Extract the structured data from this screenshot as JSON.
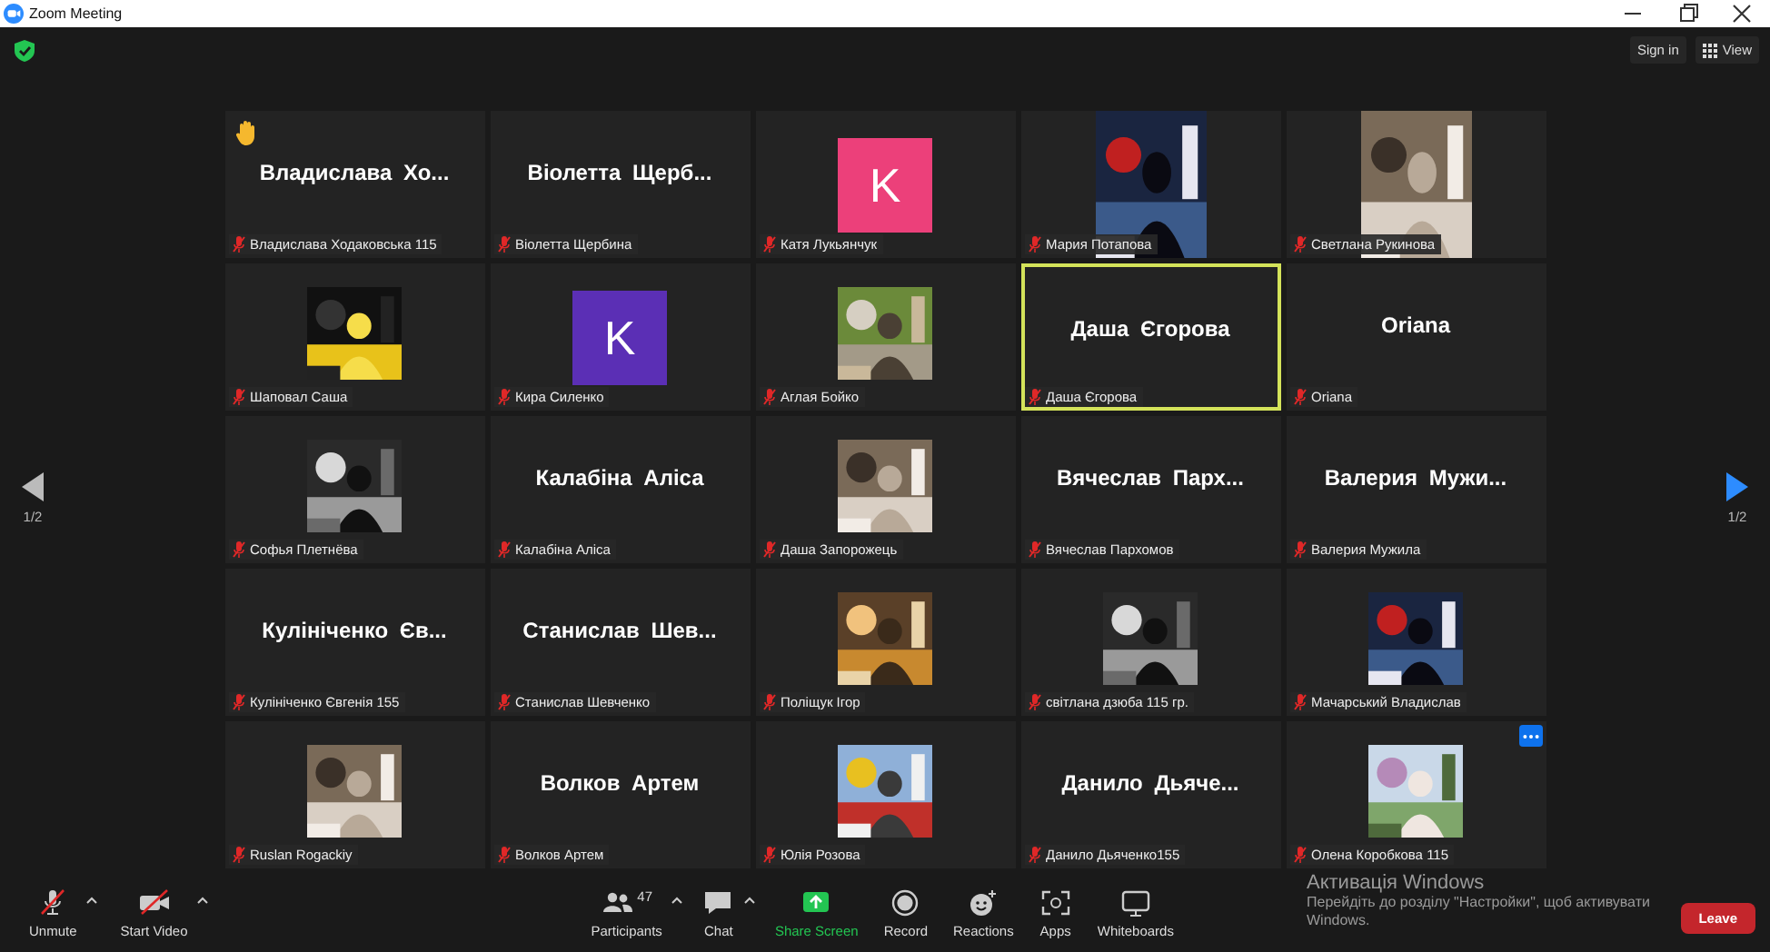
{
  "window": {
    "title": "Zoom Meeting"
  },
  "top_bar": {
    "sign_in": "Sign in",
    "view": "View"
  },
  "pager": {
    "left": "1/2",
    "right": "1/2"
  },
  "tiles": [
    {
      "kind": "name",
      "display": "Владислава Хо...",
      "label": "Владислава Ходаковська 115",
      "hand_raised": true,
      "speaking": false
    },
    {
      "kind": "name",
      "display": "Віолетта Щерб...",
      "label": "Віолетта Щербина",
      "hand_raised": false,
      "speaking": false
    },
    {
      "kind": "avatar",
      "display": "K",
      "color": "#ec407a",
      "label": "Катя Лукьянчук",
      "hand_raised": false,
      "speaking": false
    },
    {
      "kind": "video",
      "label": "Мария Потапова",
      "hand_raised": false,
      "speaking": false
    },
    {
      "kind": "video",
      "label": "Светлана Рукинова",
      "hand_raised": false,
      "speaking": false
    },
    {
      "label": "Шаповал Саша",
      "hand_raised": false,
      "speaking": false
    },
    {
      "kind": "avatar",
      "display": "K",
      "color": "#5b2fb5",
      "label": "Кира Силенко",
      "hand_raised": false,
      "speaking": false
    },
    {
      "label": "Аглая Бойко",
      "hand_raised": false,
      "speaking": false
    },
    {
      "kind": "name",
      "display": "Даша Єгорова",
      "label": "Даша Єгорова",
      "hand_raised": false,
      "speaking": true
    },
    {
      "kind": "name",
      "display": "Oriana",
      "label": "Oriana",
      "hand_raised": false,
      "speaking": false
    },
    {
      "label": "Софья Плетнёва",
      "hand_raised": false,
      "speaking": false
    },
    {
      "kind": "name",
      "display": "Калабіна Аліса",
      "label": "Калабіна Аліса",
      "hand_raised": false,
      "speaking": false
    },
    {
      "label": "Даша Запорожець",
      "hand_raised": false,
      "speaking": false
    },
    {
      "kind": "name",
      "display": "Вячеслав Парх...",
      "label": "Вячеслав Пархомов",
      "hand_raised": false,
      "speaking": false
    },
    {
      "kind": "name",
      "display": "Валерия Мужи...",
      "label": "Валерия Мужила",
      "hand_raised": false,
      "speaking": false
    },
    {
      "kind": "name",
      "display": "Кулініченко Єв...",
      "label": "Кулініченко Євгенія 155",
      "hand_raised": false,
      "speaking": false
    },
    {
      "kind": "name",
      "display": "Станислав Шев...",
      "label": "Станислав Шевченко",
      "hand_raised": false,
      "speaking": false
    },
    {
      "label": "Поліщук Ігор",
      "hand_raised": false,
      "speaking": false
    },
    {
      "label": "світлана дзюба 115 гр.",
      "hand_raised": false,
      "speaking": false
    },
    {
      "label": "Мачарський Владислав",
      "hand_raised": false,
      "speaking": false
    },
    {
      "label": "Ruslan Rogackiy",
      "hand_raised": false,
      "speaking": false
    },
    {
      "kind": "name",
      "display": "Волков Артем",
      "label": "Волков Артем",
      "hand_raised": false,
      "speaking": false
    },
    {
      "label": "Юлія Розова",
      "hand_raised": false,
      "speaking": false
    },
    {
      "kind": "name",
      "display": "Данило Дьяче...",
      "label": "Данило Дьяченко155",
      "hand_raised": false,
      "speaking": false
    },
    {
      "label": "Олена Коробкова 115",
      "hand_raised": false,
      "speaking": false,
      "menu": true
    }
  ],
  "toolbar": {
    "items": [
      {
        "kind": "mic",
        "label": "Unmute",
        "caret": true
      },
      {
        "kind": "video",
        "label": "Start Video",
        "caret": true
      },
      {
        "kind": "participants",
        "label": "Participants",
        "count": "47",
        "caret": true
      },
      {
        "kind": "chat",
        "label": "Chat",
        "caret": true
      },
      {
        "kind": "share",
        "label": "Share Screen",
        "caret": false
      },
      {
        "kind": "record",
        "label": "Record",
        "caret": false
      },
      {
        "kind": "reactions",
        "label": "Reactions",
        "caret": false
      },
      {
        "kind": "apps",
        "label": "Apps",
        "caret": false
      },
      {
        "kind": "whiteboards",
        "label": "Whiteboards",
        "caret": false
      }
    ],
    "leave": "Leave"
  },
  "os_notice": {
    "title": "Активація Windows",
    "text": "Перейдіть до розділу \"Настройки\", щоб активувати Windows."
  }
}
